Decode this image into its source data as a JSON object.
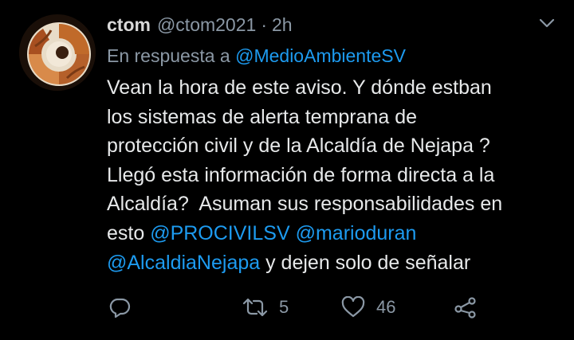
{
  "tweet": {
    "author_name": "ctom",
    "author_handle": "@ctom2021",
    "separator": "·",
    "time": "2h",
    "reply_prefix": "En respuesta a",
    "reply_to": "@MedioAmbienteSV",
    "body_lines": [
      "Vean la hora de este aviso. Y dónde estban",
      "los sistemas de alerta temprana de",
      "protección civil y de la Alcaldía de Nejapa ?",
      "Llegó esta información de forma directa a la",
      "Alcaldía?  Asuman sus responsabilidades en"
    ],
    "line6_prefix": "esto ",
    "mention_procivil": "@PROCIVILSV",
    "mention_marioduran": "@marioduran",
    "mention_alcaldia": "@AlcaldiaNejapa",
    "line7_suffix": " y dejen solo de señalar",
    "retweet_count": "5",
    "like_count": "46"
  },
  "icons": {
    "reply": "reply-icon",
    "retweet": "retweet-icon",
    "like": "heart-icon",
    "share": "share-icon",
    "more": "chevron-down-icon"
  },
  "colors": {
    "background": "#000000",
    "text": "#e7e9ea",
    "secondary": "#8b98a5",
    "link": "#1d9bf0"
  }
}
